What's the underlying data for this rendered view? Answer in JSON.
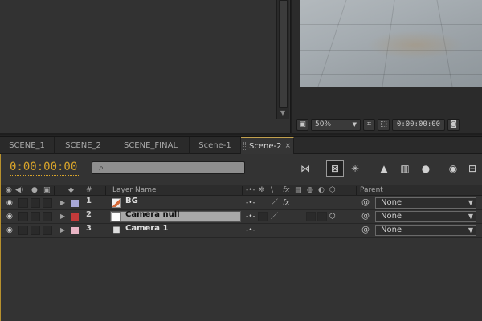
{
  "colors": {
    "timecode": "#d9a52b",
    "panel_border_active": "#b7912e",
    "label_bg": "#a8a8d8",
    "label_camera_null": "#c23a3a",
    "label_camera": "#e8b4c4"
  },
  "viewer": {
    "zoom": "50%",
    "time": "0:00:00:00"
  },
  "tabs": [
    {
      "label": "SCENE_1"
    },
    {
      "label": "SCENE_2"
    },
    {
      "label": "SCENE_FINAL"
    },
    {
      "label": "Scene-1"
    },
    {
      "label": "Scene-2",
      "active": true,
      "close": "×"
    }
  ],
  "timeline": {
    "timecode": "0:00:00:00",
    "search_placeholder": "",
    "columns": {
      "hash": "#",
      "layer_name": "Layer Name",
      "parent": "Parent"
    },
    "layers": [
      {
        "number": "1",
        "name": "BG",
        "parent": "None",
        "icon": "footage-icon"
      },
      {
        "number": "2",
        "name": "Camera null",
        "parent": "None",
        "icon": "null-icon",
        "selected": true
      },
      {
        "number": "3",
        "name": "Camera 1",
        "parent": "None",
        "icon": "camera-icon"
      }
    ]
  }
}
